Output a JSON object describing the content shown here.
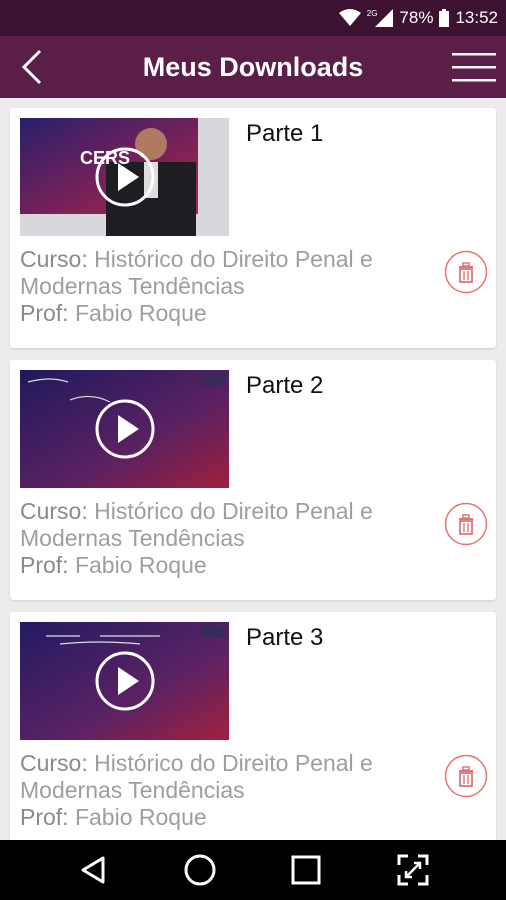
{
  "status_bar": {
    "battery": "78%",
    "time": "13:52",
    "network": "2G"
  },
  "header": {
    "title": "Meus Downloads"
  },
  "downloads": [
    {
      "part": "Parte 1",
      "course_label": "Curso:",
      "course": "Histórico do Direito Penal e Modernas Tendências",
      "prof_label": "Prof:",
      "prof": "Fabio Roque"
    },
    {
      "part": "Parte 2",
      "course_label": "Curso:",
      "course": "Histórico do Direito Penal e Modernas Tendências",
      "prof_label": "Prof:",
      "prof": "Fabio Roque"
    },
    {
      "part": "Parte 3",
      "course_label": "Curso:",
      "course": "Histórico do Direito Penal e Modernas Tendências",
      "prof_label": "Prof:",
      "prof": "Fabio Roque"
    }
  ],
  "colors": {
    "app_bar": "#5b1e49",
    "status_bar": "#3d1230",
    "delete": "#e57373"
  }
}
